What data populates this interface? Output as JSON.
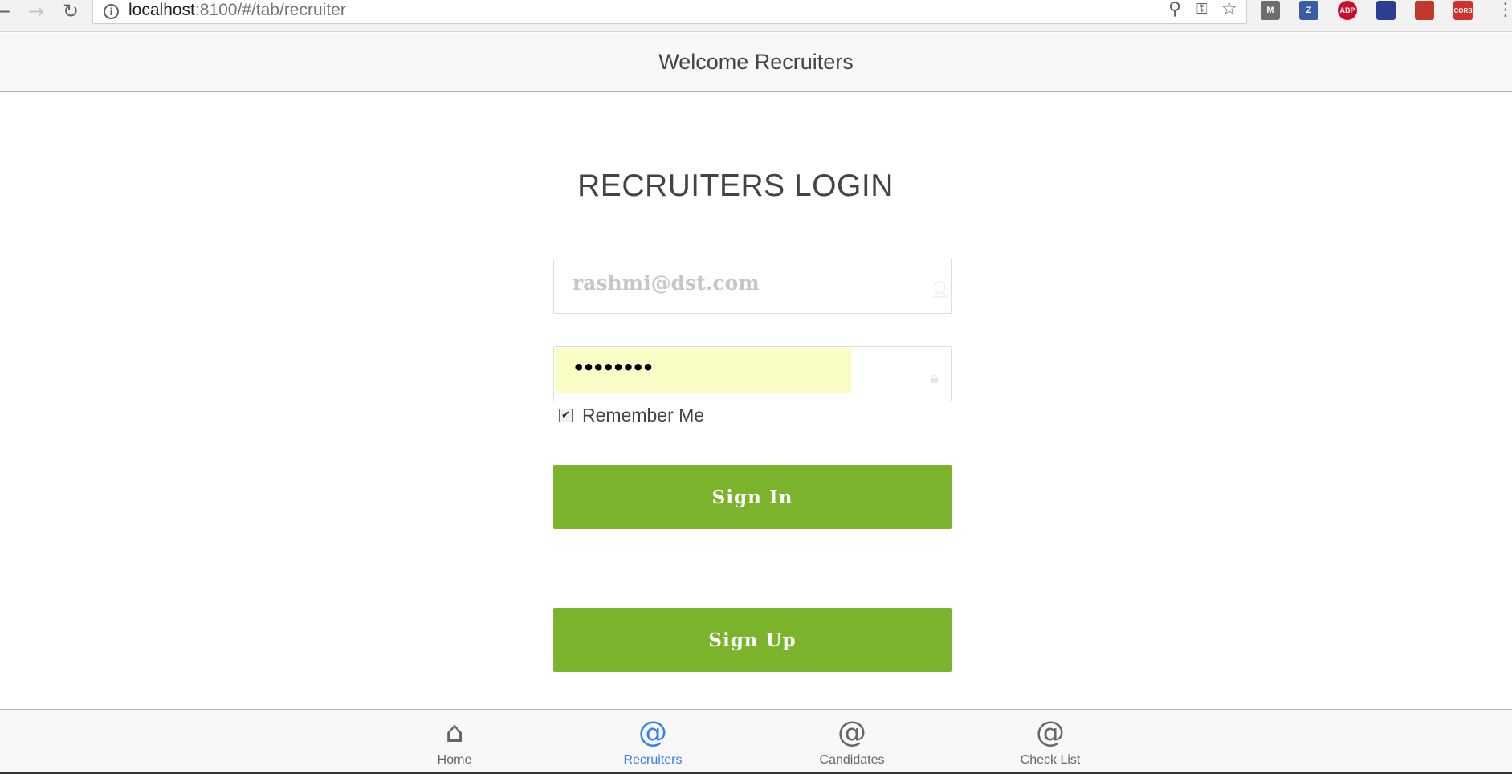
{
  "browser": {
    "url_host": "localhost",
    "url_rest": ":8100/#/tab/recruiter",
    "extensions": [
      {
        "name": "m-extension-icon",
        "label": "M",
        "color": "#6d6d6d"
      },
      {
        "name": "z-extension-icon",
        "label": "Z",
        "color": "#3b5ba5"
      },
      {
        "name": "adblock-extension-icon",
        "label": "ABP",
        "color": "#c8102e"
      },
      {
        "name": "flag-extension-icon",
        "label": "",
        "color": "#2a3f8f"
      },
      {
        "name": "book-extension-icon",
        "label": "",
        "color": "#c0392b"
      },
      {
        "name": "cors-extension-icon",
        "label": "CORS",
        "color": "#d32f2f"
      }
    ]
  },
  "header": {
    "title": "Welcome Recruiters"
  },
  "login": {
    "title": "RECRUITERS LOGIN",
    "email_value": "rashmi@dst.com",
    "password_value": "••••••••",
    "remember_label": "Remember Me",
    "remember_checked": true,
    "signin_label": "Sign In",
    "signup_label": "Sign Up"
  },
  "tabs": [
    {
      "label": "Home",
      "icon": "home-icon",
      "active": false
    },
    {
      "label": "Recruiters",
      "icon": "at-icon",
      "active": true
    },
    {
      "label": "Candidates",
      "icon": "at-icon",
      "active": false
    },
    {
      "label": "Check List",
      "icon": "at-icon",
      "active": false
    }
  ],
  "colors": {
    "button_green": "#7cb32d",
    "tab_active": "#387ef5",
    "autofill_yellow": "#fafdc5"
  }
}
